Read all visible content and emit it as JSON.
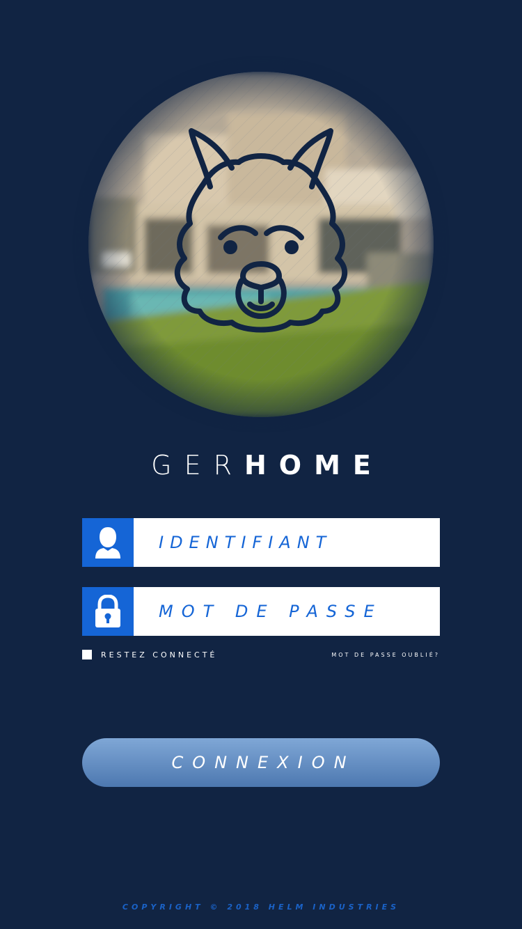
{
  "app": {
    "brand_light": "GER",
    "brand_bold": "HOME"
  },
  "hero": {
    "logo_icon": "wolf-head-icon",
    "background": "blurred-modern-house-with-pool"
  },
  "login": {
    "username_placeholder": "IDENTIFIANT",
    "username_icon": "user-icon",
    "password_placeholder": "MOT DE PASSE",
    "password_icon": "lock-icon",
    "remember_label": "RESTEZ CONNECTÉ",
    "forgot_label": "MOT DE PASSE OUBLIÉ?",
    "submit_label": "CONNEXION"
  },
  "footer": {
    "copyright": "COPYRIGHT © 2018 HELM INDUSTRIES"
  },
  "colors": {
    "background": "#112443",
    "accent": "#1565d6",
    "button_top": "#7fa7d6",
    "button_bottom": "#4d78b0"
  }
}
